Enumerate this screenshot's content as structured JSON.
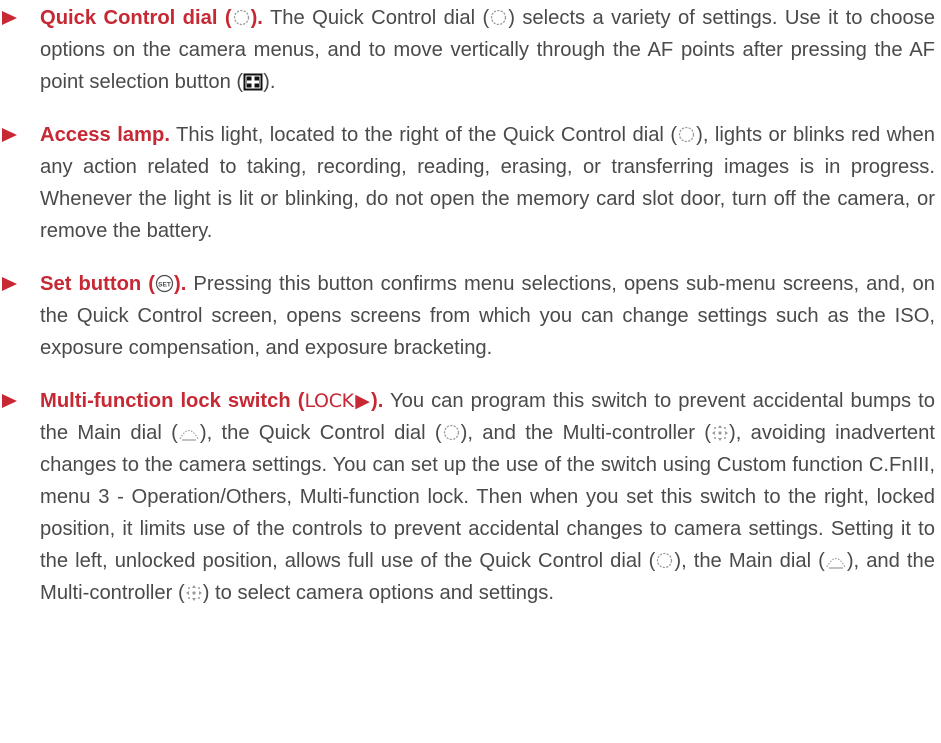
{
  "items": [
    {
      "title_a": "Quick Control dial (",
      "title_b": ").",
      "text_a": " The Quick Control dial (",
      "text_b": ") selects a variety of settings. Use it to choose options on the camera menus, and to move vertically through the AF points after pressing the AF point selection button (",
      "text_c": ")."
    },
    {
      "title": "Access lamp.",
      "text_a": " This light, located to the right of the Quick Control dial (",
      "text_b": "), lights or blinks red when any action related to taking, recording, reading, erasing, or transferring images is in progress. Whenever the light is lit or blinking, do not open the memory card slot door, turn off the camera, or remove the battery."
    },
    {
      "title_a": "Set button (",
      "title_b": ").",
      "text": " Pressing this button confirms menu selections, opens sub-menu screens, and, on the Quick Control screen, opens screens from which you can change settings such as the ISO, exposure compensation, and exposure bracketing."
    },
    {
      "title_a": "Multi-function lock switch (",
      "lock_label": "LOCK▶",
      "title_b": ").",
      "text_a": " You can program this switch to prevent accidental bumps to the Main dial (",
      "text_b": "), the Quick Control dial (",
      "text_c": "), and the Multi-controller (",
      "text_d": "), avoiding inadvertent changes to the camera settings. You can set up the use of the switch using Custom function C.FnIII, menu 3 - Operation/Others, Multi-function lock. Then when you set this switch to the right, locked position, it limits use of the controls to prevent accidental changes to camera settings. Setting it to the left, unlocked position, allows full use of the Quick Control dial (",
      "text_e": "), the Main dial (",
      "text_f": "), and the Multi-controller (",
      "text_g": ") to select camera options and settings."
    }
  ],
  "colors": {
    "accent": "#c62834",
    "text": "#4a4a4a"
  },
  "icons": [
    "bullet-arrow-icon",
    "quick-control-dial-icon",
    "af-point-selection-icon",
    "set-button-icon",
    "main-dial-icon",
    "multi-controller-icon"
  ]
}
